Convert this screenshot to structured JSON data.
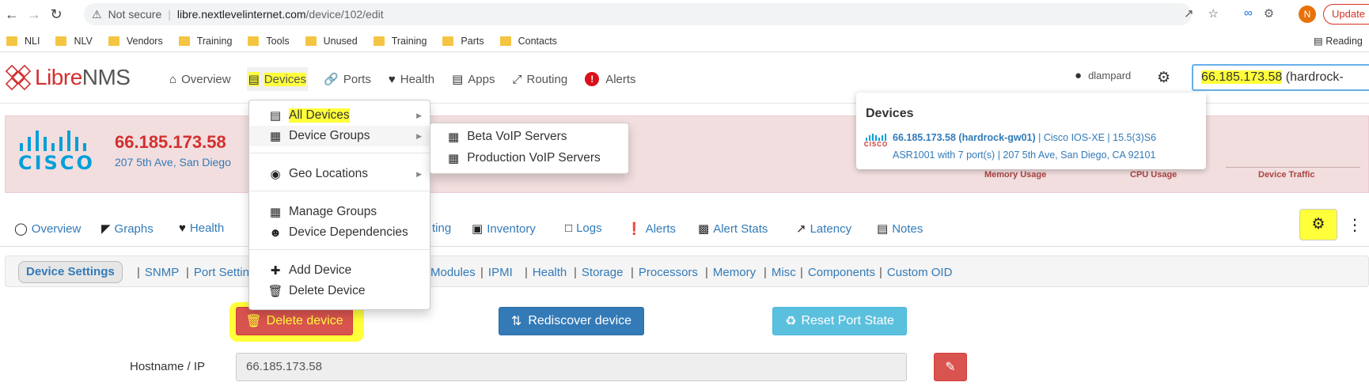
{
  "browser": {
    "security_label": "Not secure",
    "url_host": "libre.nextlevelinternet.com",
    "url_path": "/device/102/edit",
    "profile_initial": "N",
    "update_label": "Update"
  },
  "bookmarks": [
    "NLI",
    "NLV",
    "Vendors",
    "Training",
    "Tools",
    "Unused",
    "Training",
    "Parts",
    "Contacts"
  ],
  "reading_list": "Reading",
  "navbar": {
    "logo_libre": "Libre",
    "logo_nms": "NMS",
    "items": [
      {
        "label": "Overview",
        "icon": "home-icon"
      },
      {
        "label": "Devices",
        "icon": "server-icon"
      },
      {
        "label": "Ports",
        "icon": "link-icon"
      },
      {
        "label": "Health",
        "icon": "heartbeat-icon"
      },
      {
        "label": "Apps",
        "icon": "apps-icon"
      },
      {
        "label": "Routing",
        "icon": "random-icon"
      },
      {
        "label": "Alerts",
        "icon": "alert-icon"
      }
    ],
    "username": "dlampard",
    "search_highlight": "66.185.173.58",
    "search_rest": " (hardrock-"
  },
  "devices_menu": {
    "items": [
      "All Devices",
      "Device Groups",
      "Geo Locations",
      "Manage Groups",
      "Device Dependencies",
      "Add Device",
      "Delete Device"
    ],
    "groups": [
      "Beta VoIP Servers",
      "Production VoIP Servers"
    ]
  },
  "device": {
    "title": "66.185.173.58",
    "address": "207 5th Ave, San Diego",
    "vendor_logo_text": "CISCO",
    "graph_labels": [
      "Memory Usage",
      "CPU Usage",
      "Device Traffic"
    ]
  },
  "devices_popup": {
    "title": "Devices",
    "name": "66.185.173.58 (hardrock-gw01)",
    "os_info": " | Cisco IOS-XE | 15.5(3)S6",
    "line2": "ASR1001 with 7 port(s) | 207 5th Ave, San Diego, CA 92101",
    "mini_logo_text": "CISCO"
  },
  "device_tabs": [
    {
      "label": "Overview",
      "icon": "lightbulb-icon"
    },
    {
      "label": "Graphs",
      "icon": "area-chart-icon"
    },
    {
      "label": "Health",
      "icon": "heartbeat-icon"
    },
    {
      "label": "ting",
      "icon": ""
    },
    {
      "label": "Inventory",
      "icon": "cube-icon"
    },
    {
      "label": "Logs",
      "icon": "file-icon"
    },
    {
      "label": "Alerts",
      "icon": "alert-icon"
    },
    {
      "label": "Alert Stats",
      "icon": "bar-chart-icon"
    },
    {
      "label": "Latency",
      "icon": "line-chart-icon"
    },
    {
      "label": "Notes",
      "icon": "notes-icon"
    }
  ],
  "settings_nav": {
    "active": "Device Settings",
    "links": [
      "SNMP",
      "Port Settin",
      "Modules",
      "IPMI",
      "Health",
      "Storage",
      "Processors",
      "Memory",
      "Misc",
      "Components",
      "Custom OID"
    ]
  },
  "actions": {
    "delete": "Delete device",
    "rediscover": "Rediscover device",
    "reset": "Reset Port State"
  },
  "form": {
    "hostname_label": "Hostname / IP",
    "hostname_value": "66.185.173.58"
  },
  "colors": {
    "brand_red": "#d32f2f",
    "cisco_blue": "#049fd9",
    "highlight": "#ffff3a",
    "header_bg": "#f2dede"
  }
}
